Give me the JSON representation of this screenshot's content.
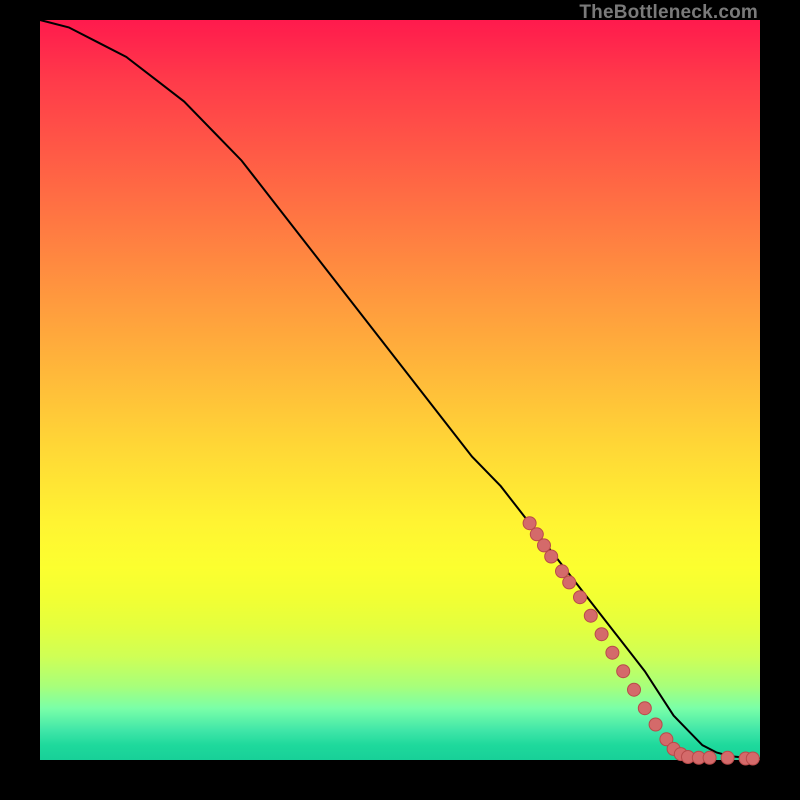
{
  "watermark": "TheBottleneck.com",
  "colors": {
    "curve": "#000000",
    "marker_fill": "#d46a6a",
    "marker_stroke": "#b94a4a",
    "bg": "#000000"
  },
  "chart_data": {
    "type": "line",
    "title": "",
    "xlabel": "",
    "ylabel": "",
    "xlim": [
      0,
      100
    ],
    "ylim": [
      0,
      100
    ],
    "grid": false,
    "legend": false,
    "series": [
      {
        "name": "curve",
        "x": [
          0,
          4,
          8,
          12,
          16,
          20,
          24,
          28,
          32,
          36,
          40,
          44,
          48,
          52,
          56,
          60,
          64,
          68,
          72,
          76,
          80,
          84,
          86,
          88,
          90,
          92,
          94,
          96,
          98,
          100
        ],
        "y": [
          100,
          99,
          97,
          95,
          92,
          89,
          85,
          81,
          76,
          71,
          66,
          61,
          56,
          51,
          46,
          41,
          37,
          32,
          27,
          22,
          17,
          12,
          9,
          6,
          4,
          2,
          1,
          0.5,
          0.3,
          0.2
        ]
      }
    ],
    "markers": [
      {
        "x": 68.0,
        "y": 32.0
      },
      {
        "x": 69.0,
        "y": 30.5
      },
      {
        "x": 70.0,
        "y": 29.0
      },
      {
        "x": 71.0,
        "y": 27.5
      },
      {
        "x": 72.5,
        "y": 25.5
      },
      {
        "x": 73.5,
        "y": 24.0
      },
      {
        "x": 75.0,
        "y": 22.0
      },
      {
        "x": 76.5,
        "y": 19.5
      },
      {
        "x": 78.0,
        "y": 17.0
      },
      {
        "x": 79.5,
        "y": 14.5
      },
      {
        "x": 81.0,
        "y": 12.0
      },
      {
        "x": 82.5,
        "y": 9.5
      },
      {
        "x": 84.0,
        "y": 7.0
      },
      {
        "x": 85.5,
        "y": 4.8
      },
      {
        "x": 87.0,
        "y": 2.8
      },
      {
        "x": 88.0,
        "y": 1.5
      },
      {
        "x": 89.0,
        "y": 0.8
      },
      {
        "x": 90.0,
        "y": 0.4
      },
      {
        "x": 91.5,
        "y": 0.3
      },
      {
        "x": 93.0,
        "y": 0.3
      },
      {
        "x": 95.5,
        "y": 0.3
      },
      {
        "x": 98.0,
        "y": 0.2
      },
      {
        "x": 99.0,
        "y": 0.2
      }
    ]
  }
}
